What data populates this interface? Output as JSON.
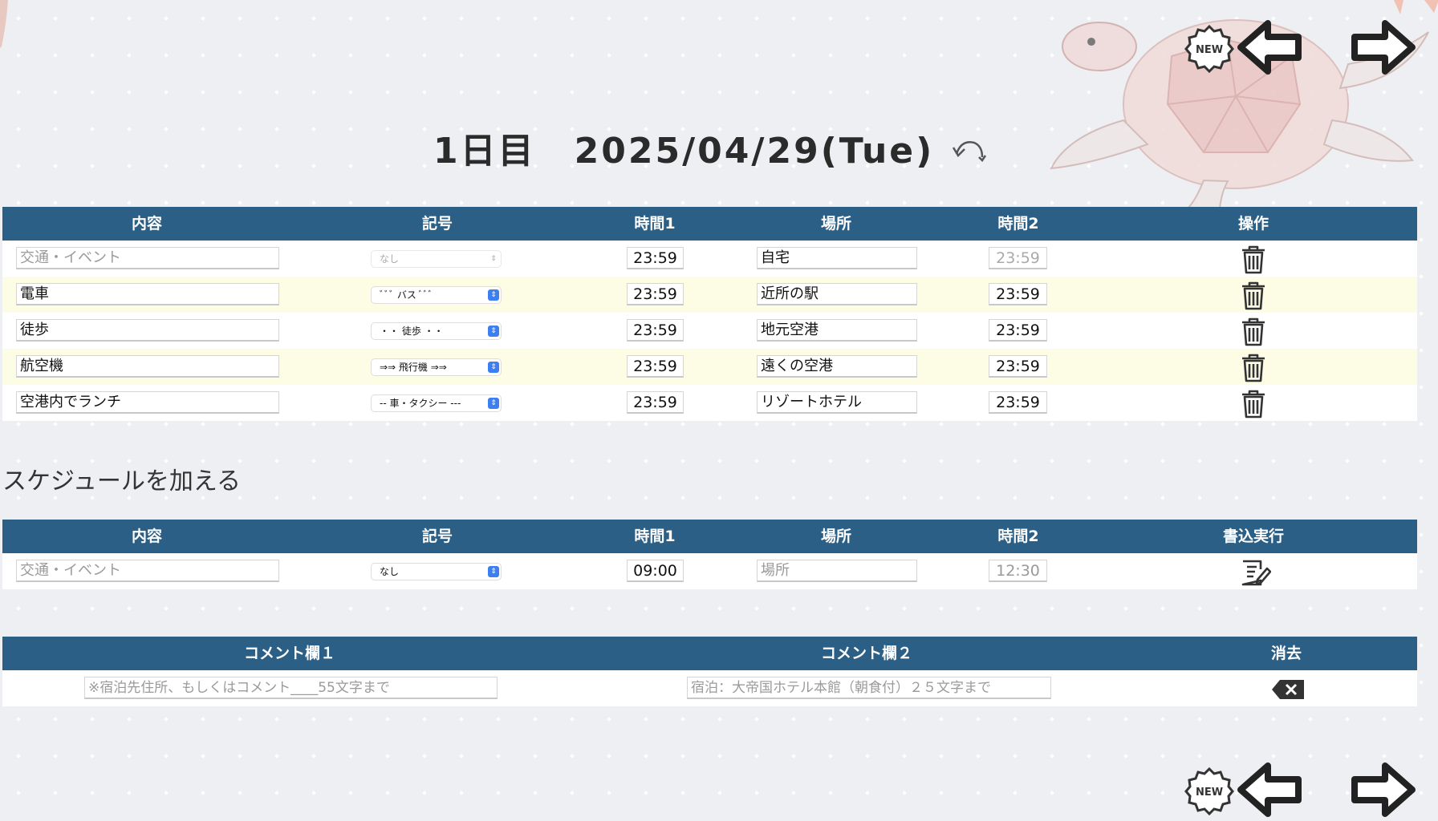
{
  "header": {
    "day_label": "1日目",
    "date": "2025/04/29(Tue)",
    "new_badge": "NEW"
  },
  "schedule_table": {
    "columns": [
      "内容",
      "記号",
      "時間1",
      "場所",
      "時間2",
      "操作"
    ],
    "rows": [
      {
        "content": "",
        "content_placeholder": "交通・イベント",
        "symbol": "なし",
        "time1": "23:59",
        "place": "自宅",
        "time2": "23:59"
      },
      {
        "content": "電車",
        "symbol": "ﾞﾞﾞ バス ﾞﾞﾞ",
        "time1": "23:59",
        "place": "近所の駅",
        "time2": "23:59"
      },
      {
        "content": "徒歩",
        "symbol": "・・ 徒歩 ・・",
        "time1": "23:59",
        "place": "地元空港",
        "time2": "23:59"
      },
      {
        "content": "航空機",
        "symbol": "⇒⇒ 飛行機 ⇒⇒",
        "time1": "23:59",
        "place": "遠くの空港",
        "time2": "23:59"
      },
      {
        "content": "空港内でランチ",
        "symbol": "-- 車・タクシー ---",
        "time1": "23:59",
        "place": "リゾートホテル",
        "time2": "23:59"
      }
    ]
  },
  "add_section": {
    "title": "スケジュールを加える",
    "columns": [
      "内容",
      "記号",
      "時間1",
      "場所",
      "時間2",
      "書込実行"
    ],
    "content_placeholder": "交通・イベント",
    "symbol": "なし",
    "time1": "09:00",
    "place_placeholder": "場所",
    "time2": "12:30"
  },
  "comment_section": {
    "columns": [
      "コメント欄１",
      "コメント欄２",
      "消去"
    ],
    "comment1_placeholder": "※宿泊先住所、もしくはコメント____55文字まで",
    "comment2_placeholder": "宿泊：大帝国ホテル本館（朝食付）２５文字まで"
  },
  "colors": {
    "header_bg": "#2b5f86",
    "alt_row": "#fdfde6",
    "select_arrow": "#3d7ff0"
  }
}
